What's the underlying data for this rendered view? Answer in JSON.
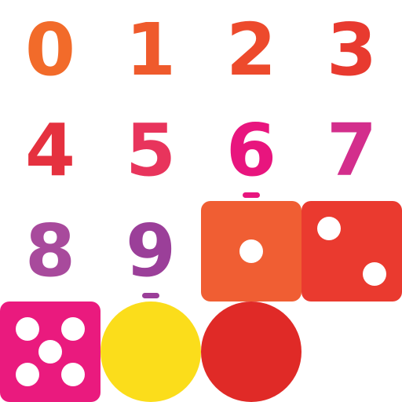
{
  "digits": [
    {
      "text": "0",
      "color": "#F26B2A"
    },
    {
      "text": "1",
      "color": "#EF5A2C"
    },
    {
      "text": "2",
      "color": "#ED4A2C"
    },
    {
      "text": "3",
      "color": "#E83A2F"
    },
    {
      "text": "4",
      "color": "#E5313F"
    },
    {
      "text": "5",
      "color": "#E8345C"
    },
    {
      "text": "6",
      "color": "#E8157E",
      "underlined": true
    },
    {
      "text": "7",
      "color": "#D32E8C"
    },
    {
      "text": "8",
      "color": "#A84A9C"
    },
    {
      "text": "9",
      "color": "#9B3F99",
      "underlined": true
    }
  ],
  "dice": [
    {
      "value": 1,
      "color": "#F05E33",
      "icon": "die-one-icon"
    },
    {
      "value": 2,
      "color": "#EA3A2F",
      "icon": "die-two-icon"
    },
    {
      "value": 5,
      "color": "#EA1A7E",
      "icon": "die-five-icon"
    }
  ],
  "balls": [
    {
      "color": "#FBDD1B",
      "icon": "yellow-ball-icon"
    },
    {
      "color": "#E02A27",
      "icon": "red-ball-icon"
    }
  ]
}
